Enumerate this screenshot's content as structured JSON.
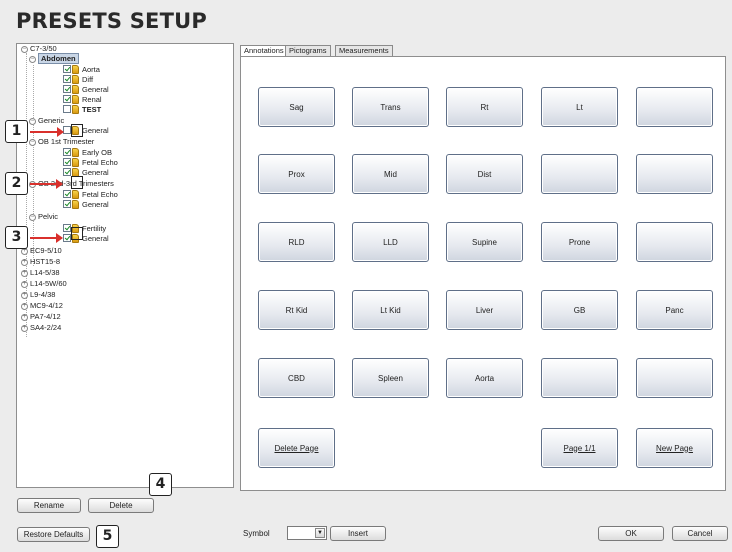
{
  "title": "PRESETS SETUP",
  "tree": {
    "root": "C7-3/50",
    "groups": [
      {
        "label": "Abdomen",
        "items": [
          "Aorta",
          "Diff",
          "General",
          "Renal",
          "TEST"
        ]
      },
      {
        "label": "Generic",
        "items": [
          "General"
        ]
      },
      {
        "label": "OB 1st Trimester",
        "items": [
          "Early OB",
          "Fetal Echo",
          "General"
        ]
      },
      {
        "label": "OB 2nd-3rd Trimesters",
        "items": [
          "Fetal Echo",
          "General"
        ]
      },
      {
        "label": "Pelvic",
        "items": [
          "Fertility",
          "General"
        ]
      }
    ],
    "collapsed": [
      "EC9-5/10",
      "HST15-8",
      "L14-5/38",
      "L14-5W/60",
      "L9-4/38",
      "MC9-4/12",
      "PA7-4/12",
      "SA4-2/24"
    ]
  },
  "panel_buttons": {
    "rename": "Rename",
    "delete": "Delete",
    "restore": "Restore Defaults"
  },
  "tabs": [
    "Annotations",
    "Pictograms",
    "Measurements"
  ],
  "annotation_buttons": [
    [
      "Sag",
      "Trans",
      "Rt",
      "Lt",
      ""
    ],
    [
      "Prox",
      "Mid",
      "Dist",
      "",
      ""
    ],
    [
      "RLD",
      "LLD",
      "Supine",
      "Prone",
      ""
    ],
    [
      "Rt Kid",
      "Lt Kid",
      "Liver",
      "GB",
      "Panc"
    ],
    [
      "CBD",
      "Spleen",
      "Aorta",
      "",
      ""
    ]
  ],
  "page_controls": {
    "delete_page": "Delete Page",
    "page": "Page 1/1",
    "new_page": "New Page"
  },
  "bottom": {
    "symbol_label": "Symbol",
    "insert": "Insert",
    "ok": "OK",
    "cancel": "Cancel"
  },
  "callouts": [
    "1",
    "2",
    "3",
    "4",
    "5"
  ],
  "colors": {
    "arrow": "#d9302c",
    "selection": "#c9d6e6",
    "button_border": "#5f6f88"
  }
}
